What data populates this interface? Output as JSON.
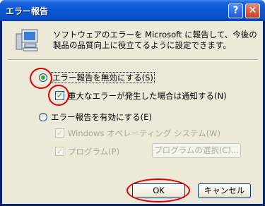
{
  "window": {
    "title": "エラー報告",
    "help_glyph": "?",
    "close_glyph": "✕"
  },
  "intro_text": "ソフトウェアのエラーを Microsoft に報告して、今後の製品の品質向上に役立てるように設定できます。",
  "options": {
    "disable_label": "エラー報告を無効にする(S)",
    "notify_label": "重大なエラーが発生した場合は通知する(N)",
    "enable_label": "エラー報告を有効にする(E)",
    "windows_os_label": "Windows オペレーティング システム(W)",
    "programs_label": "プログラム(P)",
    "choose_programs_label": "プログラムの選択(C)..."
  },
  "buttons": {
    "ok": "OK",
    "cancel": "キャンセル"
  },
  "states": {
    "disable_selected": true,
    "notify_checked": true,
    "enable_selected": false,
    "windows_os_checked": true,
    "programs_checked": true
  },
  "check_glyph": "✓",
  "annotation_color": "#e00000"
}
